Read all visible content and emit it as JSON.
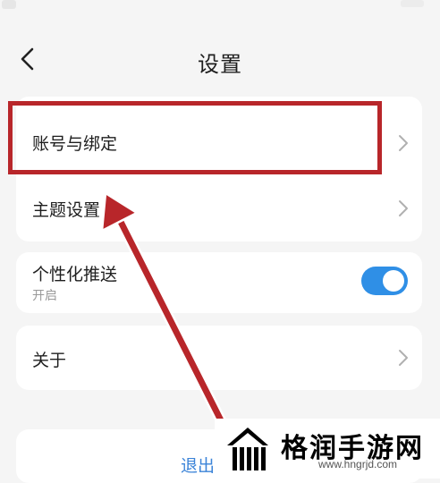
{
  "header": {
    "title": "设置",
    "back_icon": "chevron-left-icon"
  },
  "settings": {
    "account_binding": {
      "label": "账号与绑定",
      "icon": "chevron-right-icon"
    },
    "theme": {
      "label": "主题设置",
      "icon": "chevron-right-icon"
    },
    "personalized_push": {
      "label": "个性化推送",
      "status": "开启",
      "enabled": true
    },
    "about": {
      "label": "关于",
      "icon": "chevron-right-icon"
    },
    "logout": {
      "label": "退出"
    }
  },
  "watermark": {
    "title": "格润手游网",
    "url": "www.hngrjd.com"
  },
  "colors": {
    "background": "#f5f5f5",
    "card": "#ffffff",
    "accent": "#2f8fe6",
    "annotation": "#b8262a",
    "logout_text": "#3c84d8"
  }
}
